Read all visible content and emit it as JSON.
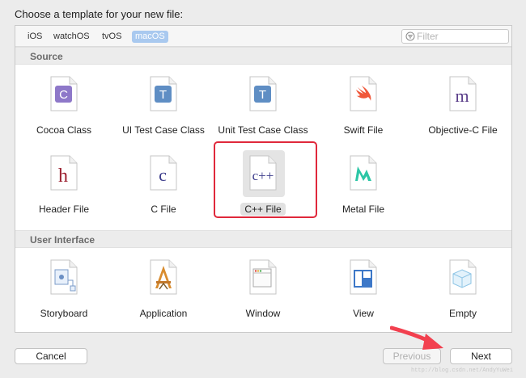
{
  "dialog": {
    "title": "Choose a template for your new file:"
  },
  "platforms": [
    {
      "label": "iOS",
      "active": false
    },
    {
      "label": "watchOS",
      "active": false
    },
    {
      "label": "tvOS",
      "active": false
    },
    {
      "label": "macOS",
      "active": true
    }
  ],
  "filter": {
    "placeholder": "Filter",
    "value": ""
  },
  "sections": {
    "source": {
      "title": "Source"
    },
    "user_interface": {
      "title": "User Interface"
    }
  },
  "source_templates": [
    {
      "label": "Cocoa Class",
      "icon": "cocoa-class-icon",
      "glyph": "C"
    },
    {
      "label": "UI Test Case Class",
      "icon": "ui-test-case-class-icon",
      "glyph": "T"
    },
    {
      "label": "Unit Test Case Class",
      "icon": "unit-test-case-class-icon",
      "glyph": "T"
    },
    {
      "label": "Swift File",
      "icon": "swift-file-icon",
      "glyph": ""
    },
    {
      "label": "Objective-C File",
      "icon": "objective-c-file-icon",
      "glyph": "m"
    },
    {
      "label": "Header File",
      "icon": "header-file-icon",
      "glyph": "h"
    },
    {
      "label": "C File",
      "icon": "c-file-icon",
      "glyph": "c"
    },
    {
      "label": "C++ File",
      "icon": "cpp-file-icon",
      "glyph": "c++",
      "selected": true
    },
    {
      "label": "Metal File",
      "icon": "metal-file-icon",
      "glyph": ""
    }
  ],
  "ui_templates": [
    {
      "label": "Storyboard",
      "icon": "storyboard-icon"
    },
    {
      "label": "Application",
      "icon": "application-icon"
    },
    {
      "label": "Window",
      "icon": "window-icon"
    },
    {
      "label": "View",
      "icon": "view-icon"
    },
    {
      "label": "Empty",
      "icon": "empty-icon"
    }
  ],
  "buttons": {
    "cancel": "Cancel",
    "previous": "Previous",
    "next": "Next"
  },
  "watermark": "http://blog.csdn.net/AndyYuWei",
  "colors": {
    "selection_outline": "#e0283b",
    "platform_active": "#a9c9ef",
    "arrow": "#f2404f"
  }
}
